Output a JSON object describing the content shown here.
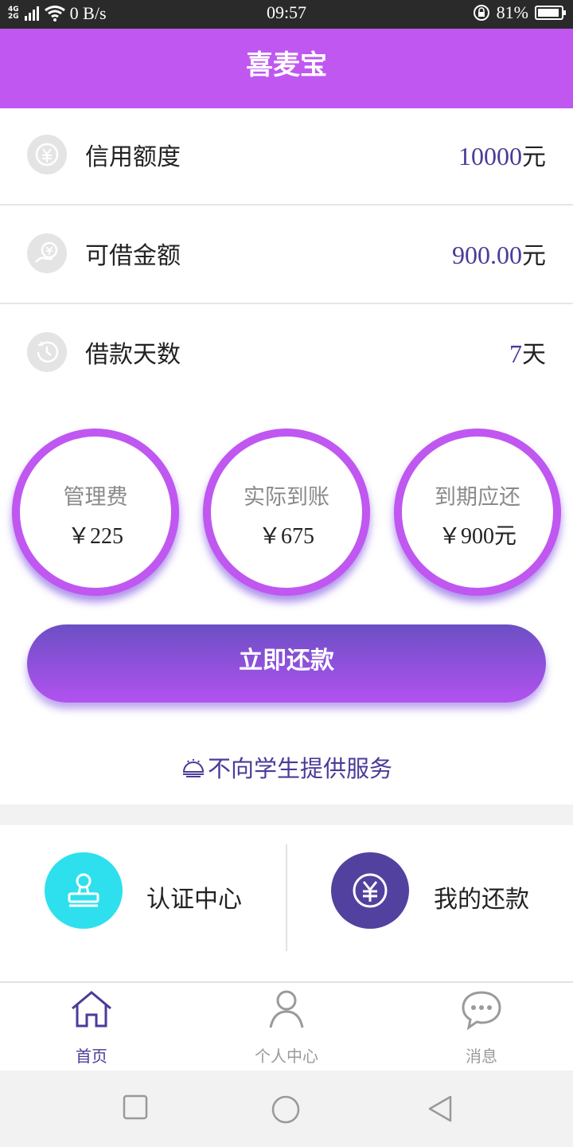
{
  "status": {
    "network": [
      "4G",
      "2G"
    ],
    "speed": "0 B/s",
    "time": "09:57",
    "battery": "81%",
    "battery_level": 0.81
  },
  "header": {
    "title": "喜麦宝"
  },
  "info_rows": [
    {
      "icon": "yen-circle-icon",
      "label": "信用额度",
      "value": "10000",
      "unit": "元"
    },
    {
      "icon": "yen-hand-icon",
      "label": "可借金额",
      "value": "900.00",
      "unit": "元"
    },
    {
      "icon": "clock-history-icon",
      "label": "借款天数",
      "value": "7",
      "unit": "天"
    }
  ],
  "stats": [
    {
      "title": "管理费",
      "value": "￥225"
    },
    {
      "title": "实际到账",
      "value": "￥675"
    },
    {
      "title": "到期应还",
      "value": "￥900元"
    }
  ],
  "repay_button": "立即还款",
  "notice": "不向学生提供服务",
  "quick_links": [
    {
      "label": "认证中心",
      "icon": "stamp-icon",
      "color": "#2ee0ee"
    },
    {
      "label": "我的还款",
      "icon": "yen-icon",
      "color": "#52419f"
    }
  ],
  "tabs": [
    {
      "label": "首页",
      "icon": "home-icon",
      "active": true
    },
    {
      "label": "个人中心",
      "icon": "person-icon",
      "active": false
    },
    {
      "label": "消息",
      "icon": "chat-bubble-icon",
      "active": false
    }
  ],
  "colors": {
    "accent": "#c057f0",
    "primary_text": "#4b3b98",
    "inactive": "#9a9a9a"
  }
}
